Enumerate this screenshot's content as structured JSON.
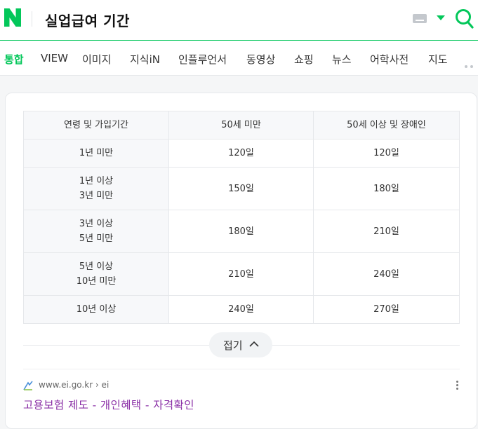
{
  "header": {
    "query": "실업급여 기간",
    "logo_icon": "naver-n-logo-icon",
    "brand_color": "#03c75a"
  },
  "tabs": [
    {
      "label": "통합",
      "active": true
    },
    {
      "label": "VIEW"
    },
    {
      "label": "이미지"
    },
    {
      "label": "지식iN"
    },
    {
      "label": "인플루언서"
    },
    {
      "label": "동영상"
    },
    {
      "label": "쇼핑"
    },
    {
      "label": "뉴스"
    },
    {
      "label": "어학사전"
    },
    {
      "label": "지도"
    }
  ],
  "table": {
    "headers": [
      "연령 및 가입기간",
      "50세 미만",
      "50세 이상 및 장애인"
    ],
    "rows": [
      {
        "period_line1": "1년 미만",
        "period_line2": "",
        "under50": "120일",
        "over50": "120일"
      },
      {
        "period_line1": "1년 이상",
        "period_line2": "3년 미만",
        "under50": "150일",
        "over50": "180일"
      },
      {
        "period_line1": "3년 이상",
        "period_line2": "5년 미만",
        "under50": "180일",
        "over50": "210일"
      },
      {
        "period_line1": "5년 이상",
        "period_line2": "10년 미만",
        "under50": "210일",
        "over50": "240일"
      },
      {
        "period_line1": "10년 이상",
        "period_line2": "",
        "under50": "240일",
        "over50": "270일"
      }
    ]
  },
  "collapse_button": {
    "label": "접기"
  },
  "result": {
    "source": "www.ei.go.kr › ei",
    "title": "고용보험 제도 - 개인혜택 - 자격확인",
    "title_color": "#8a2fa6"
  }
}
